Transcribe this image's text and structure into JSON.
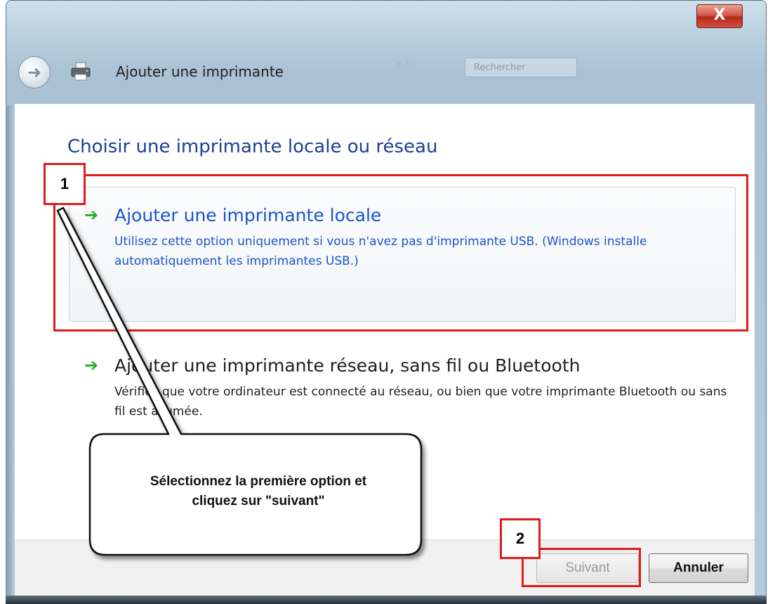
{
  "window": {
    "title": "Ajouter une imprimante",
    "close_label": "X",
    "search_placeholder": "Rechercher"
  },
  "content": {
    "heading": "Choisir une imprimante locale ou réseau",
    "options": [
      {
        "title": "Ajouter une imprimante locale",
        "description": "Utilisez cette option uniquement si vous n'avez pas d'imprimante USB. (Windows installe automatiquement les imprimantes USB.)"
      },
      {
        "title": "Ajouter une imprimante réseau, sans fil ou Bluetooth",
        "description": "Vérifiez que votre ordinateur est connecté au réseau, ou bien que votre imprimante Bluetooth ou sans fil est allumée."
      }
    ]
  },
  "annotations": {
    "step1": "1",
    "step2": "2",
    "callout_line1": "Sélectionnez la première option et",
    "callout_line2": "cliquez sur \"suivant\"",
    "color": "#e01b1b"
  },
  "footer": {
    "next_label": "Suivant",
    "cancel_label": "Annuler"
  },
  "icons": {
    "back": "back-arrow-icon",
    "printer": "printer-icon",
    "option_arrow": "green-arrow-icon"
  }
}
